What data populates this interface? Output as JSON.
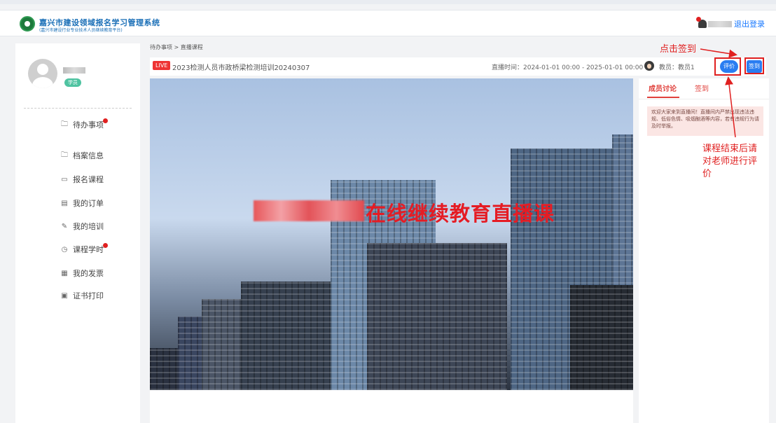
{
  "header": {
    "system_title": "嘉兴市建设领域报名学习管理系统",
    "system_subtitle": "(嘉兴市建设行业专业技术人员继续教育平台)",
    "logout_label": "退出登录"
  },
  "sidebar": {
    "user_badge": "学员",
    "items": [
      {
        "label": "待办事项",
        "icon": "folder-icon",
        "has_dot": true
      },
      {
        "label": "档案信息",
        "icon": "folder-icon",
        "has_dot": false
      },
      {
        "label": "报名课程",
        "icon": "calendar-icon",
        "has_dot": false
      },
      {
        "label": "我的订单",
        "icon": "order-icon",
        "has_dot": false
      },
      {
        "label": "我的培训",
        "icon": "pencil-icon",
        "has_dot": false
      },
      {
        "label": "课程学时",
        "icon": "clock-icon",
        "has_dot": true
      },
      {
        "label": "我的发票",
        "icon": "invoice-icon",
        "has_dot": false
      },
      {
        "label": "证书打印",
        "icon": "certificate-icon",
        "has_dot": false
      }
    ]
  },
  "breadcrumb": "待办事项 > 直播课程",
  "course": {
    "live_tag": "LIVE",
    "title": "2023检测人员市政桥梁检测培训20240307",
    "live_time": "直播时间：2024-01-01 00:00 - 2025-01-01 00:00",
    "teacher": "教员：教员1",
    "evaluate_label": "评价",
    "sign_label": "签到"
  },
  "video": {
    "overlay_title": "在线继续教育直播课"
  },
  "panel": {
    "tabs": [
      "成员讨论",
      "签到"
    ],
    "notice": "欢迎大家来到直播间！直播间内严禁出现违法违规、低俗色情、吸烟酗酒等内容，若有违规行为请及时举报。"
  },
  "annotations": {
    "sign_hint": "点击签到",
    "eval_hint_lines": [
      "课程结束后请",
      "对老师进行评",
      "价"
    ]
  },
  "colors": {
    "accent_blue": "#2a7df1",
    "alert_red": "#e02020",
    "tab_red": "#e0413c",
    "brand_green": "#1d7a3c"
  }
}
